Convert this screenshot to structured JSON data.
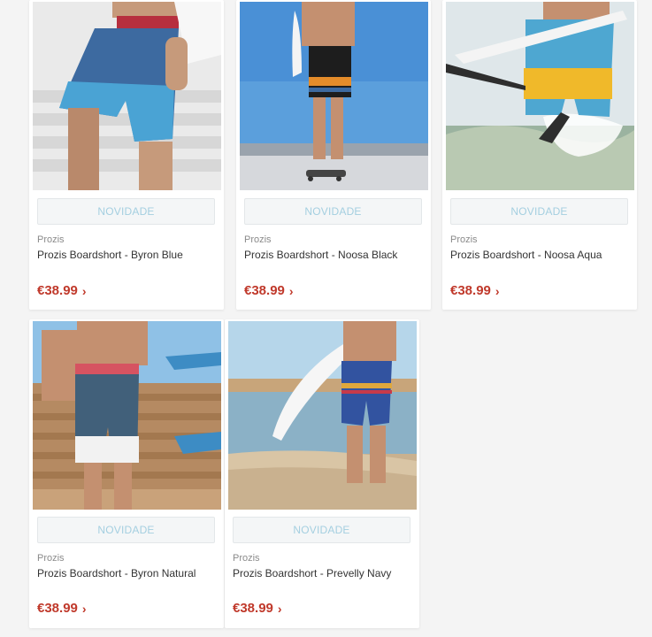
{
  "products": [
    {
      "badge": "NOVIDADE",
      "brand": "Prozis",
      "name": "Prozis Boardshort - Byron Blue",
      "price": "€38.99",
      "image": "man-holding-surfboard-blue-patterned-boardshorts"
    },
    {
      "badge": "NOVIDADE",
      "brand": "Prozis",
      "name": "Prozis Boardshort - Noosa Black",
      "price": "€38.99",
      "image": "man-on-skateboard-black-orange-striped-boardshorts"
    },
    {
      "badge": "NOVIDADE",
      "brand": "Prozis",
      "name": "Prozis Boardshort - Noosa Aqua",
      "price": "€38.99",
      "image": "man-in-surf-aqua-yellow-boardshorts"
    },
    {
      "badge": "NOVIDADE",
      "brand": "Prozis",
      "name": "Prozis Boardshort - Byron Natural",
      "price": "€38.99",
      "image": "man-with-surfboards-natural-patterned-boardshorts"
    },
    {
      "badge": "NOVIDADE",
      "brand": "Prozis",
      "name": "Prozis Boardshort - Prevelly Navy",
      "price": "€38.99",
      "image": "man-on-beach-navy-striped-boardshorts"
    }
  ],
  "colors": {
    "price": "#c0392b",
    "badge_text": "#a4cfe0",
    "background": "#f4f4f4"
  },
  "icons": {
    "price_arrow": "chevron-right-icon"
  }
}
